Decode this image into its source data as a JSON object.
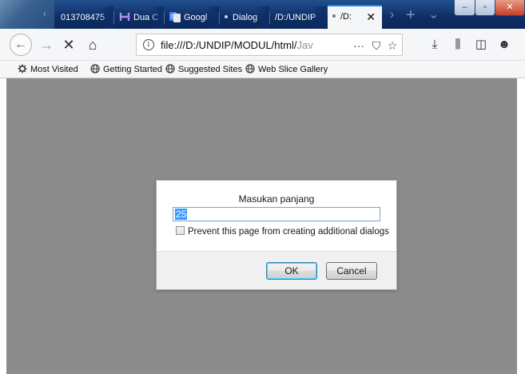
{
  "browser": {
    "tabs": [
      {
        "label": "013708475",
        "active": false
      },
      {
        "label": "Dua C",
        "active": false
      },
      {
        "label": "Googl",
        "active": false
      },
      {
        "label": "Dialog",
        "active": false
      },
      {
        "label": "/D:/UNDIP",
        "active": false
      },
      {
        "label": "/D:",
        "active": true
      }
    ],
    "new_tab_glyph": "+",
    "tab_list_glyph": "⌄",
    "close_tab_glyph": "✕"
  },
  "window_controls": {
    "minimize": "–",
    "maximize": "▫",
    "close": "✕"
  },
  "toolbar": {
    "back_glyph": "←",
    "forward_glyph": "→",
    "stop_glyph": "✕",
    "home_glyph": "⌂",
    "url": "file:///D:/UNDIP/MODUL/html/Jav",
    "url_prefix": "file:///D:/UNDIP/MODUL/html/",
    "url_suffix": "Jav",
    "page_actions_glyph": "···",
    "pocket_glyph": "⛉",
    "bookmark_star_glyph": "☆",
    "downloads_glyph": "⤓",
    "library_glyph": "⫼",
    "sidebar_glyph": "◫",
    "extension_glyph": "☻"
  },
  "bookmarks": [
    {
      "label": "Most Visited",
      "icon": "gear-icon"
    },
    {
      "label": "Getting Started",
      "icon": "globe-icon"
    },
    {
      "label": "Suggested Sites",
      "icon": "globe-icon"
    },
    {
      "label": "Web Slice Gallery",
      "icon": "globe-icon"
    }
  ],
  "dialog": {
    "message": "Masukan panjang",
    "input_value": "25",
    "checkbox_label": "Prevent this page from creating additional dialogs",
    "checkbox_checked": false,
    "ok_label": "OK",
    "cancel_label": "Cancel"
  },
  "colors": {
    "tabstrip": "#0d2e66",
    "active_tab_accent": "#0a84ff",
    "content_overlay": "#8c8c8c",
    "selection": "#3399ff"
  }
}
